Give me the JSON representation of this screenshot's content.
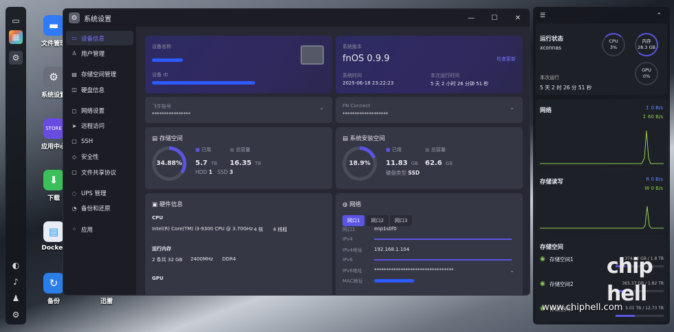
{
  "window": {
    "title": "系统设置"
  },
  "window_controls": {
    "minimize": "—",
    "maximize": "☐",
    "close": "✕"
  },
  "dock_icons": [
    "display-icon",
    "apps-icon",
    "settings-icon",
    "help-icon",
    "bell-icon",
    "user-icon",
    "gear-icon"
  ],
  "desktop": [
    {
      "label": "文件管理",
      "color": "#2f7bf5"
    },
    {
      "label": "系统设置",
      "color": "#6a6f7b"
    },
    {
      "label": "应用中心",
      "color": "#6a4be0"
    },
    {
      "label": "下载",
      "color": "#3bbf5b"
    },
    {
      "label": "Docker",
      "color": "#e8edf5"
    },
    {
      "label": "备份",
      "color": "#2b7ee8"
    },
    {
      "label": "迅雷",
      "color": "transparent"
    }
  ],
  "sidebar": {
    "items": [
      {
        "icon": "▭",
        "label": "设备信息",
        "active": true
      },
      {
        "icon": "♙",
        "label": "用户管理"
      },
      {
        "icon": "▤",
        "label": "存储空间管理"
      },
      {
        "icon": "◫",
        "label": "硬盘信息"
      },
      {
        "icon": "◻",
        "label": "网络设置"
      },
      {
        "icon": "➤",
        "label": "远程访问"
      },
      {
        "icon": "▢",
        "label": "SSH"
      },
      {
        "icon": "◇",
        "label": "安全性"
      },
      {
        "icon": "▢",
        "label": "文件共享协议"
      },
      {
        "icon": "◌",
        "label": "UPS 管理"
      },
      {
        "icon": "◔",
        "label": "备份和还原"
      },
      {
        "icon": "⁘",
        "label": "应用"
      }
    ]
  },
  "device": {
    "name_label": "设备名称",
    "id_label": "设备 ID"
  },
  "system": {
    "version_label": "系统版本",
    "version": "fnOS  0.9.9",
    "check_update": "检查更新",
    "time_label": "系统时间",
    "time": "2025-06-18 23:22:23",
    "uptime_label": "本次运行时间",
    "uptime": "5 天 2 小时 26 分钟 51 秒"
  },
  "feiniu": {
    "label": "飞牛账号",
    "value": "****************"
  },
  "fnconnect": {
    "label": "FN Connect",
    "value": "*******************"
  },
  "storage": {
    "title": "存储空间",
    "percent": "34.88%",
    "percent_value": 34.88,
    "used_label": "已用",
    "used": "5.7",
    "used_unit": "TB",
    "total_label": "总容量",
    "total": "16.35",
    "total_unit": "TB",
    "hdd_label": "HDD",
    "hdd": "1",
    "ssd_label": "SSD",
    "ssd": "3"
  },
  "sysinstall": {
    "title": "系统安装空间",
    "percent": "18.9%",
    "percent_value": 18.9,
    "used_label": "已用",
    "used": "11.83",
    "used_unit": "GB",
    "total_label": "总容量",
    "total": "62.6",
    "total_unit": "GB",
    "disk_type_label": "硬盘类型",
    "disk_type": "SSD"
  },
  "hardware": {
    "title": "硬件信息",
    "cpu_label": "CPU",
    "cpu": "Intel(R) Core(TM) i3-9300 CPU @ 3.70GHz",
    "cores": "4 核",
    "threads": "4 线程",
    "mem_label": "运行内存",
    "mem": "2 条共 32 GB",
    "mem_speed": "2400MHz",
    "mem_type": "DDR4",
    "gpu_label": "GPU"
  },
  "network": {
    "title": "网络",
    "tabs": [
      "网口1",
      "网口2",
      "网口3"
    ],
    "port_label": "网口1",
    "port": "enp1s0f0",
    "ipv4_label": "IPv4",
    "ipv4_addr_label": "IPv4地址",
    "ipv4_addr": "192.168.1.104",
    "ipv6_label": "IPv6",
    "ipv6_addr_label": "IPv6地址",
    "ipv6_addr": "*********************************",
    "mac_label": "MAC地址"
  },
  "panel": {
    "status_title": "运行状态",
    "host": "xconnas",
    "uptime_label": "本次运行",
    "uptime": "5 天 2 时 26 分 51 秒",
    "cpu_label": "CPU",
    "cpu": "3%",
    "cpu_value": 3,
    "mem_label": "内存",
    "mem": "28.3 GB",
    "mem_value": 88,
    "gpu_label": "GPU",
    "gpu": "0%",
    "gpu_value": 0,
    "net_title": "网络",
    "net_up": "0 B/s",
    "net_down": "60 B/s",
    "disk_title": "存储读写",
    "disk_read_label": "R",
    "disk_read": "0 B/s",
    "disk_write_label": "W",
    "disk_write": "0 B/s",
    "vol_title": "存储空间",
    "volumes": [
      {
        "name": "存储空间1",
        "value": "374.82 GB / 1.8 TB"
      },
      {
        "name": "存储空间2",
        "value": "365.37 GB / 1.82 TB"
      },
      {
        "name": "存储空间3",
        "value": "5.01 TB / 12.73 TB"
      }
    ]
  },
  "watermark": {
    "text": "www.chiphell.com",
    "logo": "chip hell"
  },
  "colors": {
    "accent": "#5b55e6",
    "up": "#5b8cff",
    "down": "#8fd14f"
  }
}
